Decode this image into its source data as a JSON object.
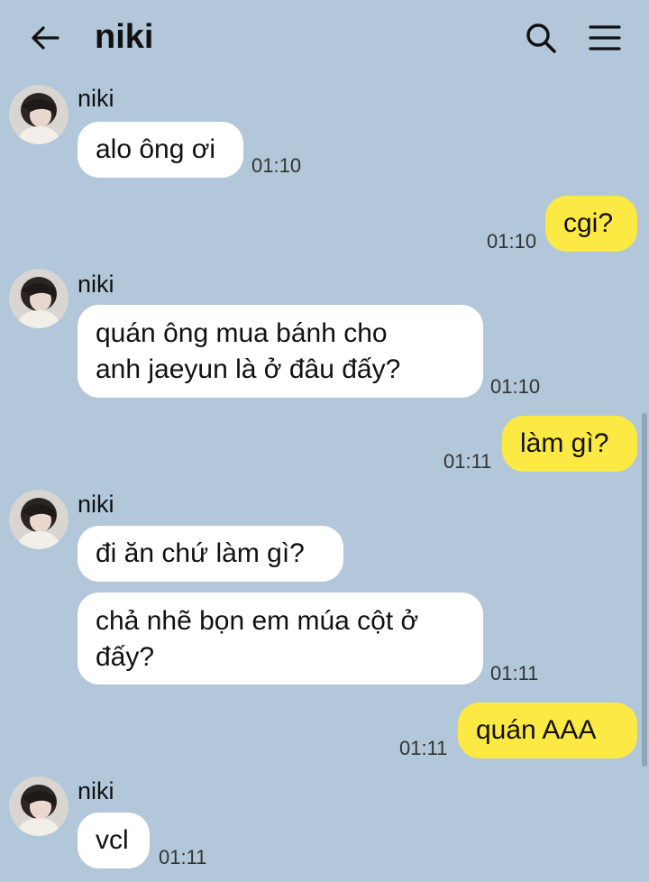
{
  "header": {
    "title": "niki",
    "back_icon": "arrow-left-icon",
    "search_icon": "search-icon",
    "menu_icon": "hamburger-menu-icon"
  },
  "colors": {
    "background": "#b2c7d9",
    "incoming_bubble": "#ffffff",
    "outgoing_bubble": "#fde944"
  },
  "messages": [
    {
      "id": "m1",
      "direction": "in",
      "sender": "niki",
      "text": "alo ông ơi",
      "time": "01:10"
    },
    {
      "id": "m2",
      "direction": "out",
      "text": "cgi?",
      "time": "01:10"
    },
    {
      "id": "m3",
      "direction": "in",
      "sender": "niki",
      "lines": [
        "quán ông mua bánh cho",
        "anh jaeyun là ở đâu đấy?"
      ],
      "time": "01:10"
    },
    {
      "id": "m4",
      "direction": "out",
      "text": "làm gì?",
      "time": "01:11"
    },
    {
      "id": "m5",
      "direction": "in",
      "sender": "niki",
      "text": "đi ăn chứ làm gì?"
    },
    {
      "id": "m6",
      "direction": "in",
      "lines": [
        "chả nhẽ bọn em múa cột ở",
        "đấy?"
      ],
      "time": "01:11"
    },
    {
      "id": "m7",
      "direction": "out",
      "text": "quán AAA",
      "time": "01:11"
    },
    {
      "id": "m8",
      "direction": "in",
      "sender": "niki",
      "text": "vcl",
      "time": "01:11"
    }
  ]
}
